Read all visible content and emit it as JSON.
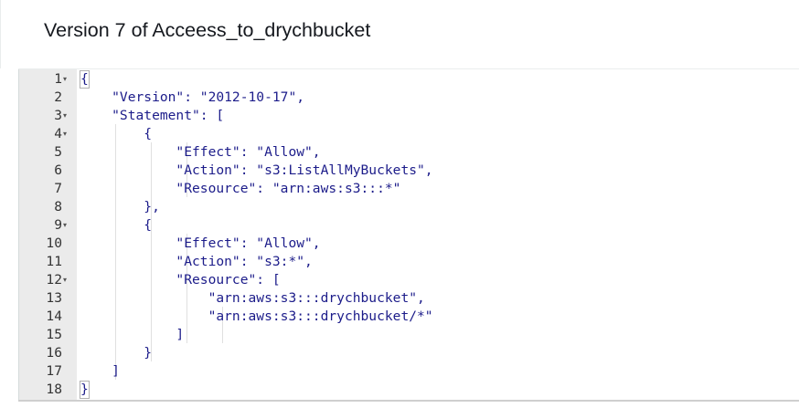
{
  "header": {
    "title": "Version 7 of Acceess_to_drychbucket"
  },
  "editor": {
    "lines": [
      {
        "n": "1",
        "fold": true,
        "text": "{"
      },
      {
        "n": "2",
        "fold": false,
        "text": "    \"Version\": \"2012-10-17\","
      },
      {
        "n": "3",
        "fold": true,
        "text": "    \"Statement\": ["
      },
      {
        "n": "4",
        "fold": true,
        "text": "        {"
      },
      {
        "n": "5",
        "fold": false,
        "text": "            \"Effect\": \"Allow\","
      },
      {
        "n": "6",
        "fold": false,
        "text": "            \"Action\": \"s3:ListAllMyBuckets\","
      },
      {
        "n": "7",
        "fold": false,
        "text": "            \"Resource\": \"arn:aws:s3:::*\""
      },
      {
        "n": "8",
        "fold": false,
        "text": "        },"
      },
      {
        "n": "9",
        "fold": true,
        "text": "        {"
      },
      {
        "n": "10",
        "fold": false,
        "text": "            \"Effect\": \"Allow\","
      },
      {
        "n": "11",
        "fold": false,
        "text": "            \"Action\": \"s3:*\","
      },
      {
        "n": "12",
        "fold": true,
        "text": "            \"Resource\": ["
      },
      {
        "n": "13",
        "fold": false,
        "text": "                \"arn:aws:s3:::drychbucket\","
      },
      {
        "n": "14",
        "fold": false,
        "text": "                \"arn:aws:s3:::drychbucket/*\""
      },
      {
        "n": "15",
        "fold": false,
        "text": "            ]"
      },
      {
        "n": "16",
        "fold": false,
        "text": "        }"
      },
      {
        "n": "17",
        "fold": false,
        "text": "    ]"
      },
      {
        "n": "18",
        "fold": false,
        "text": "}"
      }
    ]
  }
}
